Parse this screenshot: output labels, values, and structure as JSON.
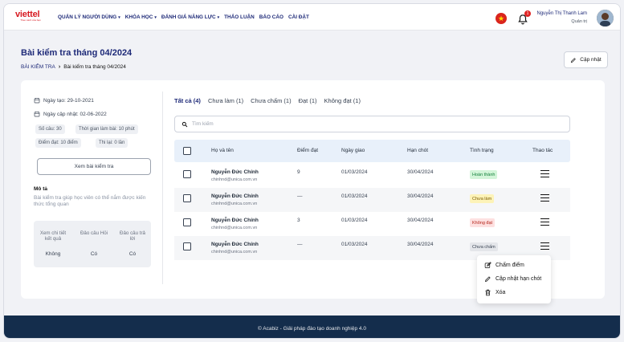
{
  "nav": {
    "logo_text": "viettel",
    "logo_sub": "Theo cách của bạn",
    "items": [
      {
        "label": "QUẢN LÝ NGƯỜI DÙNG",
        "dropdown": true
      },
      {
        "label": "KHÓA HỌC",
        "dropdown": true
      },
      {
        "label": "ĐÁNH GIÁ NĂNG LỰC",
        "dropdown": true
      },
      {
        "label": "THẢO LUẬN",
        "dropdown": false
      },
      {
        "label": "BÁO CÁO",
        "dropdown": false
      },
      {
        "label": "CÀI ĐẶT",
        "dropdown": false
      }
    ],
    "notification_count": "1",
    "user_name": "Nguyễn Thị Thanh Lam",
    "user_role": "Quản trị"
  },
  "header": {
    "title": "Bài kiểm tra tháng 04/2024",
    "breadcrumb_link": "BÀI KIỂM TRA",
    "breadcrumb_current": "Bài kiểm tra tháng 04/2024",
    "update_label": "Cập nhật"
  },
  "info": {
    "created": "Ngày tạo: 29-10-2021",
    "updated": "Ngày cập nhật: 02-06-2022",
    "chips": [
      "Số câu: 30",
      "Thời gian làm bài: 10 phút",
      "Điểm đạt: 10 điểm",
      "Thi lại: 0 lần"
    ],
    "view_button": "Xem bài kiểm tra",
    "desc_title": "Mô tả",
    "desc_text": "Bài kiểm tra giúp học viên có thể nắm được kiến thức tổng quan",
    "settings": [
      {
        "label": "Xem chi tiết kết quả",
        "value": "Không"
      },
      {
        "label": "Đảo câu Hỏi",
        "value": "Có"
      },
      {
        "label": "Đảo câu trả lời",
        "value": "Có"
      }
    ]
  },
  "tabs": [
    "Tất cả (4)",
    "Chưa làm (1)",
    "Chưa chấm (1)",
    "Đạt (1)",
    "Không đạt (1)"
  ],
  "search": {
    "placeholder": "Tìm kiếm",
    "value": ""
  },
  "table": {
    "headers": [
      "Họ và tên",
      "Điểm đạt",
      "Ngày giao",
      "Hạn chót",
      "Tình trạng",
      "Thao tác"
    ],
    "rows": [
      {
        "name": "Nguyễn Đức Chính",
        "email": "chinhnd@unica.com.vn",
        "score": "9",
        "assigned": "01/03/2024",
        "deadline": "30/04/2024",
        "status": "Hoàn thành"
      },
      {
        "name": "Nguyễn Đức Chính",
        "email": "chinhnd@unica.com.vn",
        "score": "—",
        "assigned": "01/03/2024",
        "deadline": "30/04/2024",
        "status": "Chưa làm"
      },
      {
        "name": "Nguyễn Đức Chính",
        "email": "chinhnd@unica.com.vn",
        "score": "3",
        "assigned": "01/03/2024",
        "deadline": "30/04/2024",
        "status": "Không đạt"
      },
      {
        "name": "Nguyễn Đức Chính",
        "email": "chinhnd@unica.com.vn",
        "score": "—",
        "assigned": "01/03/2024",
        "deadline": "30/04/2024",
        "status": "Chưa chấm"
      }
    ]
  },
  "status_colors": {
    "done": {
      "bg": "#d3f5d9",
      "fg": "#15803d"
    },
    "todo": {
      "bg": "#fdf3b8",
      "fg": "#7a5b00"
    },
    "fail": {
      "bg": "#fde0e0",
      "fg": "#b42318"
    },
    "pending": {
      "bg": "#e4e6ea",
      "fg": "#374151"
    }
  },
  "action_menu": {
    "items": [
      {
        "label": "Chấm điểm",
        "icon": "edit-square-icon"
      },
      {
        "label": "Cập nhật hạn chót",
        "icon": "pencil-icon"
      },
      {
        "label": "Xóa",
        "icon": "trash-icon"
      }
    ]
  },
  "footer": {
    "text": "© Acabiz - Giải pháp đào tạo doanh nghiệp 4.0"
  },
  "colors": {
    "primary": "#1e2a78",
    "brand_red": "#d71920",
    "footer_bg": "#142d4c"
  }
}
